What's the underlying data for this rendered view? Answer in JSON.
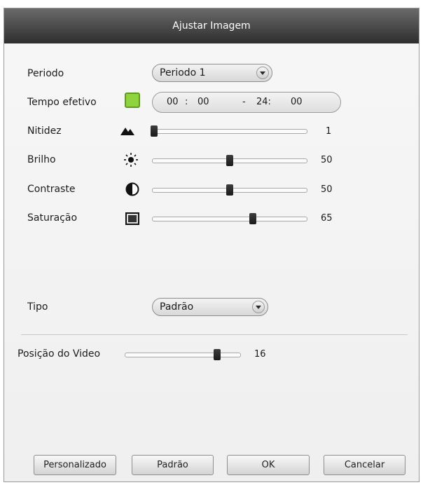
{
  "dialog": {
    "title": "Ajustar Imagem"
  },
  "periodo": {
    "label": "Periodo",
    "value": "Periodo 1"
  },
  "tempo": {
    "label": "Tempo efetivo",
    "enabled": true,
    "start_h": "00",
    "sep1": ":",
    "start_m": "00",
    "dash": "-",
    "end_h": "24:",
    "end_m": "00"
  },
  "sliders": {
    "nitidez": {
      "label": "Nitidez",
      "value": "1",
      "level": 1,
      "max": 100,
      "icon": "sharpness-icon"
    },
    "brilho": {
      "label": "Brilho",
      "value": "50",
      "level": 50,
      "max": 100,
      "icon": "brightness-icon"
    },
    "contraste": {
      "label": "Contraste",
      "value": "50",
      "level": 50,
      "max": 100,
      "icon": "contrast-icon"
    },
    "saturacao": {
      "label": "Saturação",
      "value": "65",
      "level": 65,
      "max": 100,
      "icon": "saturation-icon"
    }
  },
  "tipo": {
    "label": "Tipo",
    "value": "Padrão"
  },
  "posicao": {
    "label": "Posição do Video",
    "value": "16",
    "level": 16,
    "max": 20
  },
  "buttons": {
    "personalizado": "Personalizado",
    "padrao": "Padrão",
    "ok": "OK",
    "cancelar": "Cancelar"
  },
  "colors": {
    "titlebar": "#3f3f3f",
    "checkbox": "#8fd33e"
  }
}
